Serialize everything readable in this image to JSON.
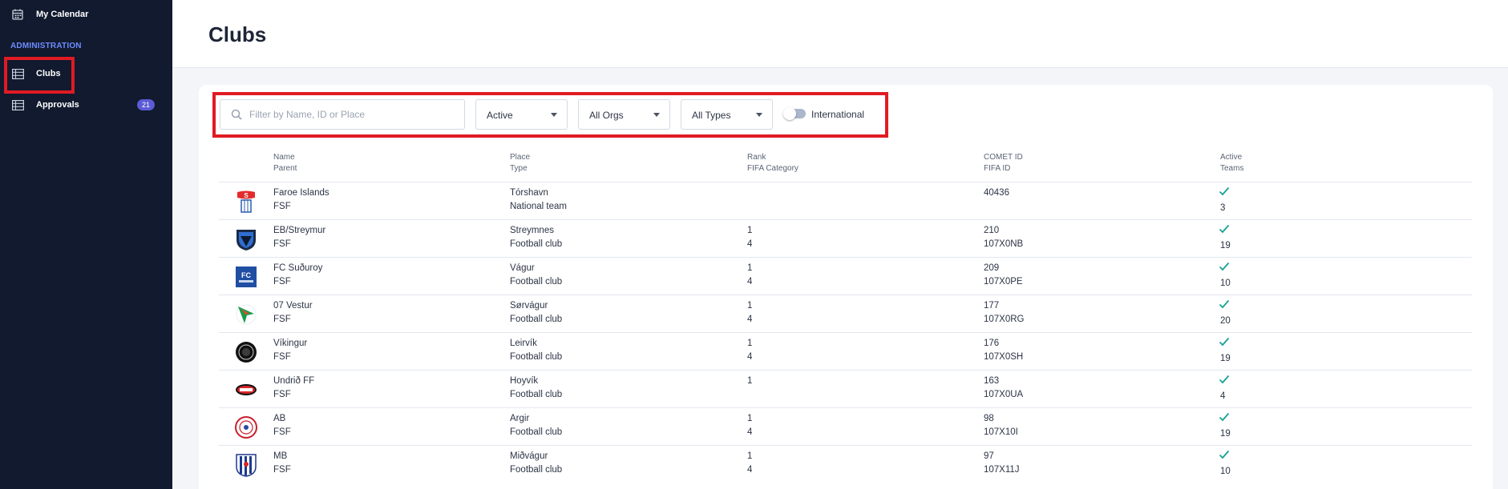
{
  "sidebar": {
    "calendar_label": "My Calendar",
    "section_title": "ADMINISTRATION",
    "items": [
      {
        "label": "Clubs",
        "icon": "table-list-icon"
      },
      {
        "label": "Approvals",
        "icon": "table-list-icon",
        "badge": "21"
      }
    ]
  },
  "header": {
    "title": "Clubs"
  },
  "filters": {
    "search_placeholder": "Filter by Name, ID or Place",
    "search_value": "",
    "status_select": "Active",
    "orgs_select": "All Orgs",
    "types_select": "All Types",
    "international_label": "International",
    "international_on": false
  },
  "table": {
    "headers": [
      {
        "line1": "Name",
        "line2": "Parent"
      },
      {
        "line1": "Place",
        "line2": "Type"
      },
      {
        "line1": "Rank",
        "line2": "FIFA Category"
      },
      {
        "line1": "COMET ID",
        "line2": "FIFA ID"
      },
      {
        "line1": "Active",
        "line2": "Teams"
      }
    ],
    "rows": [
      {
        "name": "Faroe Islands",
        "parent": "FSF",
        "place": "Tórshavn",
        "type": "National team",
        "rank": "",
        "fifa_category": "",
        "comet_id": "40436",
        "fifa_id": "",
        "active": true,
        "teams": "3",
        "logo": "national-crest"
      },
      {
        "name": "EB/Streymur",
        "parent": "FSF",
        "place": "Streymnes",
        "type": "Football club",
        "rank": "1",
        "fifa_category": "4",
        "comet_id": "210",
        "fifa_id": "107X0NB",
        "active": true,
        "teams": "19",
        "logo": "shield-dark"
      },
      {
        "name": "FC Suðuroy",
        "parent": "FSF",
        "place": "Vágur",
        "type": "Football club",
        "rank": "1",
        "fifa_category": "4",
        "comet_id": "209",
        "fifa_id": "107X0PE",
        "active": true,
        "teams": "10",
        "logo": "square-blue"
      },
      {
        "name": "07 Vestur",
        "parent": "FSF",
        "place": "Sørvágur",
        "type": "Football club",
        "rank": "1",
        "fifa_category": "4",
        "comet_id": "177",
        "fifa_id": "107X0RG",
        "active": true,
        "teams": "20",
        "logo": "arrow-green"
      },
      {
        "name": "Víkingur",
        "parent": "FSF",
        "place": "Leirvík",
        "type": "Football club",
        "rank": "1",
        "fifa_category": "4",
        "comet_id": "176",
        "fifa_id": "107X0SH",
        "active": true,
        "teams": "19",
        "logo": "circle-dark"
      },
      {
        "name": "Undrið FF",
        "parent": "FSF",
        "place": "Hoyvík",
        "type": "Football club",
        "rank": "1",
        "fifa_category": "",
        "comet_id": "163",
        "fifa_id": "107X0UA",
        "active": true,
        "teams": "4",
        "logo": "oval-red"
      },
      {
        "name": "AB",
        "parent": "FSF",
        "place": "Argir",
        "type": "Football club",
        "rank": "1",
        "fifa_category": "4",
        "comet_id": "98",
        "fifa_id": "107X10I",
        "active": true,
        "teams": "19",
        "logo": "circle-red"
      },
      {
        "name": "MB",
        "parent": "FSF",
        "place": "Miðvágur",
        "type": "Football club",
        "rank": "1",
        "fifa_category": "4",
        "comet_id": "97",
        "fifa_id": "107X11J",
        "active": true,
        "teams": "10",
        "logo": "shield-stripes"
      }
    ]
  },
  "colors": {
    "sidebar_bg": "#111a2e",
    "section_title": "#6f8cff",
    "badge_bg": "#5b5bd6",
    "check": "#16a394",
    "highlight": "#e01b24"
  }
}
